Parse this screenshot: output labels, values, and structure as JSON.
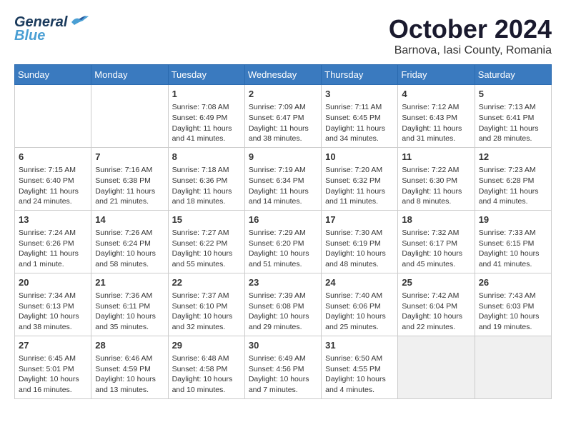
{
  "header": {
    "logo_general": "General",
    "logo_blue": "Blue",
    "month": "October 2024",
    "location": "Barnova, Iasi County, Romania"
  },
  "days_of_week": [
    "Sunday",
    "Monday",
    "Tuesday",
    "Wednesday",
    "Thursday",
    "Friday",
    "Saturday"
  ],
  "weeks": [
    [
      {
        "day": "",
        "info": ""
      },
      {
        "day": "",
        "info": ""
      },
      {
        "day": "1",
        "sunrise": "Sunrise: 7:08 AM",
        "sunset": "Sunset: 6:49 PM",
        "daylight": "Daylight: 11 hours and 41 minutes."
      },
      {
        "day": "2",
        "sunrise": "Sunrise: 7:09 AM",
        "sunset": "Sunset: 6:47 PM",
        "daylight": "Daylight: 11 hours and 38 minutes."
      },
      {
        "day": "3",
        "sunrise": "Sunrise: 7:11 AM",
        "sunset": "Sunset: 6:45 PM",
        "daylight": "Daylight: 11 hours and 34 minutes."
      },
      {
        "day": "4",
        "sunrise": "Sunrise: 7:12 AM",
        "sunset": "Sunset: 6:43 PM",
        "daylight": "Daylight: 11 hours and 31 minutes."
      },
      {
        "day": "5",
        "sunrise": "Sunrise: 7:13 AM",
        "sunset": "Sunset: 6:41 PM",
        "daylight": "Daylight: 11 hours and 28 minutes."
      }
    ],
    [
      {
        "day": "6",
        "sunrise": "Sunrise: 7:15 AM",
        "sunset": "Sunset: 6:40 PM",
        "daylight": "Daylight: 11 hours and 24 minutes."
      },
      {
        "day": "7",
        "sunrise": "Sunrise: 7:16 AM",
        "sunset": "Sunset: 6:38 PM",
        "daylight": "Daylight: 11 hours and 21 minutes."
      },
      {
        "day": "8",
        "sunrise": "Sunrise: 7:18 AM",
        "sunset": "Sunset: 6:36 PM",
        "daylight": "Daylight: 11 hours and 18 minutes."
      },
      {
        "day": "9",
        "sunrise": "Sunrise: 7:19 AM",
        "sunset": "Sunset: 6:34 PM",
        "daylight": "Daylight: 11 hours and 14 minutes."
      },
      {
        "day": "10",
        "sunrise": "Sunrise: 7:20 AM",
        "sunset": "Sunset: 6:32 PM",
        "daylight": "Daylight: 11 hours and 11 minutes."
      },
      {
        "day": "11",
        "sunrise": "Sunrise: 7:22 AM",
        "sunset": "Sunset: 6:30 PM",
        "daylight": "Daylight: 11 hours and 8 minutes."
      },
      {
        "day": "12",
        "sunrise": "Sunrise: 7:23 AM",
        "sunset": "Sunset: 6:28 PM",
        "daylight": "Daylight: 11 hours and 4 minutes."
      }
    ],
    [
      {
        "day": "13",
        "sunrise": "Sunrise: 7:24 AM",
        "sunset": "Sunset: 6:26 PM",
        "daylight": "Daylight: 11 hours and 1 minute."
      },
      {
        "day": "14",
        "sunrise": "Sunrise: 7:26 AM",
        "sunset": "Sunset: 6:24 PM",
        "daylight": "Daylight: 10 hours and 58 minutes."
      },
      {
        "day": "15",
        "sunrise": "Sunrise: 7:27 AM",
        "sunset": "Sunset: 6:22 PM",
        "daylight": "Daylight: 10 hours and 55 minutes."
      },
      {
        "day": "16",
        "sunrise": "Sunrise: 7:29 AM",
        "sunset": "Sunset: 6:20 PM",
        "daylight": "Daylight: 10 hours and 51 minutes."
      },
      {
        "day": "17",
        "sunrise": "Sunrise: 7:30 AM",
        "sunset": "Sunset: 6:19 PM",
        "daylight": "Daylight: 10 hours and 48 minutes."
      },
      {
        "day": "18",
        "sunrise": "Sunrise: 7:32 AM",
        "sunset": "Sunset: 6:17 PM",
        "daylight": "Daylight: 10 hours and 45 minutes."
      },
      {
        "day": "19",
        "sunrise": "Sunrise: 7:33 AM",
        "sunset": "Sunset: 6:15 PM",
        "daylight": "Daylight: 10 hours and 41 minutes."
      }
    ],
    [
      {
        "day": "20",
        "sunrise": "Sunrise: 7:34 AM",
        "sunset": "Sunset: 6:13 PM",
        "daylight": "Daylight: 10 hours and 38 minutes."
      },
      {
        "day": "21",
        "sunrise": "Sunrise: 7:36 AM",
        "sunset": "Sunset: 6:11 PM",
        "daylight": "Daylight: 10 hours and 35 minutes."
      },
      {
        "day": "22",
        "sunrise": "Sunrise: 7:37 AM",
        "sunset": "Sunset: 6:10 PM",
        "daylight": "Daylight: 10 hours and 32 minutes."
      },
      {
        "day": "23",
        "sunrise": "Sunrise: 7:39 AM",
        "sunset": "Sunset: 6:08 PM",
        "daylight": "Daylight: 10 hours and 29 minutes."
      },
      {
        "day": "24",
        "sunrise": "Sunrise: 7:40 AM",
        "sunset": "Sunset: 6:06 PM",
        "daylight": "Daylight: 10 hours and 25 minutes."
      },
      {
        "day": "25",
        "sunrise": "Sunrise: 7:42 AM",
        "sunset": "Sunset: 6:04 PM",
        "daylight": "Daylight: 10 hours and 22 minutes."
      },
      {
        "day": "26",
        "sunrise": "Sunrise: 7:43 AM",
        "sunset": "Sunset: 6:03 PM",
        "daylight": "Daylight: 10 hours and 19 minutes."
      }
    ],
    [
      {
        "day": "27",
        "sunrise": "Sunrise: 6:45 AM",
        "sunset": "Sunset: 5:01 PM",
        "daylight": "Daylight: 10 hours and 16 minutes."
      },
      {
        "day": "28",
        "sunrise": "Sunrise: 6:46 AM",
        "sunset": "Sunset: 4:59 PM",
        "daylight": "Daylight: 10 hours and 13 minutes."
      },
      {
        "day": "29",
        "sunrise": "Sunrise: 6:48 AM",
        "sunset": "Sunset: 4:58 PM",
        "daylight": "Daylight: 10 hours and 10 minutes."
      },
      {
        "day": "30",
        "sunrise": "Sunrise: 6:49 AM",
        "sunset": "Sunset: 4:56 PM",
        "daylight": "Daylight: 10 hours and 7 minutes."
      },
      {
        "day": "31",
        "sunrise": "Sunrise: 6:50 AM",
        "sunset": "Sunset: 4:55 PM",
        "daylight": "Daylight: 10 hours and 4 minutes."
      },
      {
        "day": "",
        "info": ""
      },
      {
        "day": "",
        "info": ""
      }
    ]
  ]
}
